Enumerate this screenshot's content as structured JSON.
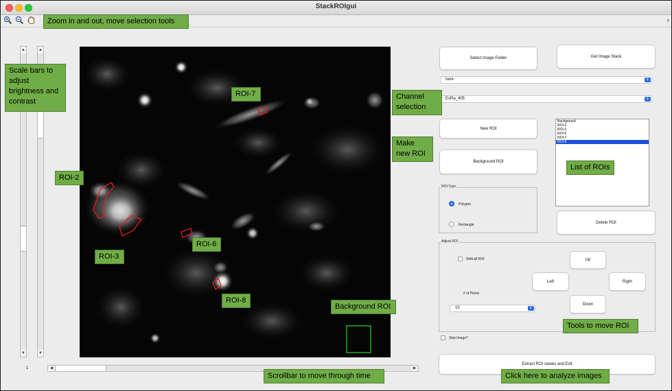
{
  "window": {
    "title": "StackROIgui"
  },
  "toolbar": {
    "zoom_in_icon": "zoom-in-icon",
    "zoom_out_icon": "zoom-out-icon",
    "pan_icon": "hand-pan-icon",
    "overflow_icon": "chevron-right-icon"
  },
  "annotations": {
    "zoom": "Zoom in and out, move selection tools",
    "scale_bars": "Scale bars to adjust brightness and contrast",
    "roi2": "ROI-2",
    "roi3": "ROI-3",
    "roi6": "ROI-6",
    "roi7": "ROI-7",
    "roi8": "ROI-8",
    "background_roi": "Background ROI",
    "channel": "Channel selection",
    "make_roi": "Make new ROI",
    "list_rois": "List of ROIs",
    "tools_move": "Tools to move ROI",
    "scrollbar_time": "Scrollbar to move through time",
    "analyze": "Click here to analyze images"
  },
  "frame_counter": "1",
  "buttons": {
    "select_folder": "Select Image Folder",
    "get_stack": "Get Image Stack",
    "new_roi": "New ROI",
    "background_roi": "Background ROI",
    "delete_roi": "Delete ROI",
    "up": "Up",
    "left": "Left",
    "right": "Right",
    "down": "Down",
    "extract": "Extract ROI values and Exit"
  },
  "folder_popup": {
    "value": "here"
  },
  "channel_popup": {
    "value": "ExRa_405"
  },
  "roi_list": {
    "items": [
      "Background",
      "ROI-2",
      "ROI-3",
      "ROI-6",
      "ROI-7",
      "ROI-8"
    ],
    "selected_index": 5
  },
  "roi_type": {
    "title": "ROI Type",
    "options": [
      "Polygon",
      "Rectangle"
    ],
    "selected": "Polygon"
  },
  "adjust_roi": {
    "title": "Adjust ROI",
    "shift_all_label": "Shift all ROI",
    "pixels_label": "# of Pixels",
    "pixels_value": "10"
  },
  "skip_image_label": "Skip Image?",
  "colors": {
    "accent_blue": "#2a6fe0",
    "annotation_green": "#70ad47",
    "roi_red": "#e02020",
    "background_roi_green": "#1fcf1f"
  }
}
